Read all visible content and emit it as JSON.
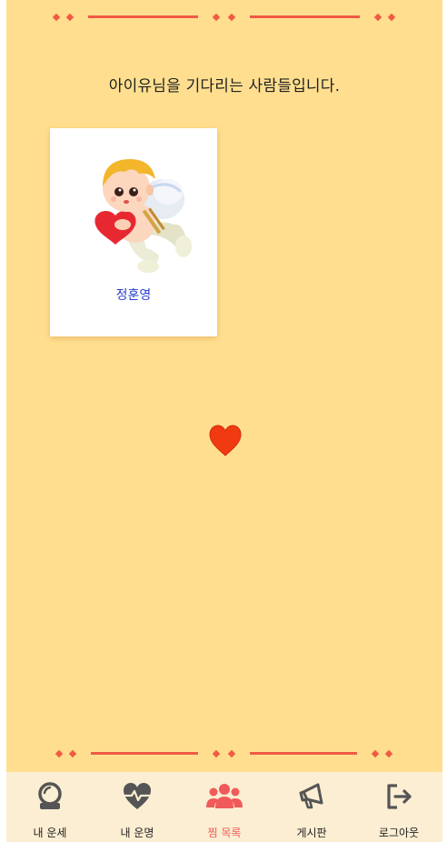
{
  "header": {
    "message": "아이유님을 기다리는 사람들입니다."
  },
  "cards": [
    {
      "name": "정훈영",
      "image": "cupid-with-heart"
    }
  ],
  "decor": {
    "center_icon": "heart-icon"
  },
  "nav": {
    "active": "찜 목록",
    "items": [
      {
        "label": "내 운세",
        "icon": "crystal-ball-icon"
      },
      {
        "label": "내 운명",
        "icon": "heart-pulse-icon"
      },
      {
        "label": "찜 목록",
        "icon": "users-icon"
      },
      {
        "label": "게시판",
        "icon": "megaphone-icon"
      },
      {
        "label": "로그아웃",
        "icon": "logout-icon"
      }
    ]
  },
  "colors": {
    "background": "#ffdf8f",
    "accent": "#f05a45",
    "nav_bg": "#fbeed2",
    "active": "#f05a5a",
    "name_link": "#2b3fcf"
  }
}
